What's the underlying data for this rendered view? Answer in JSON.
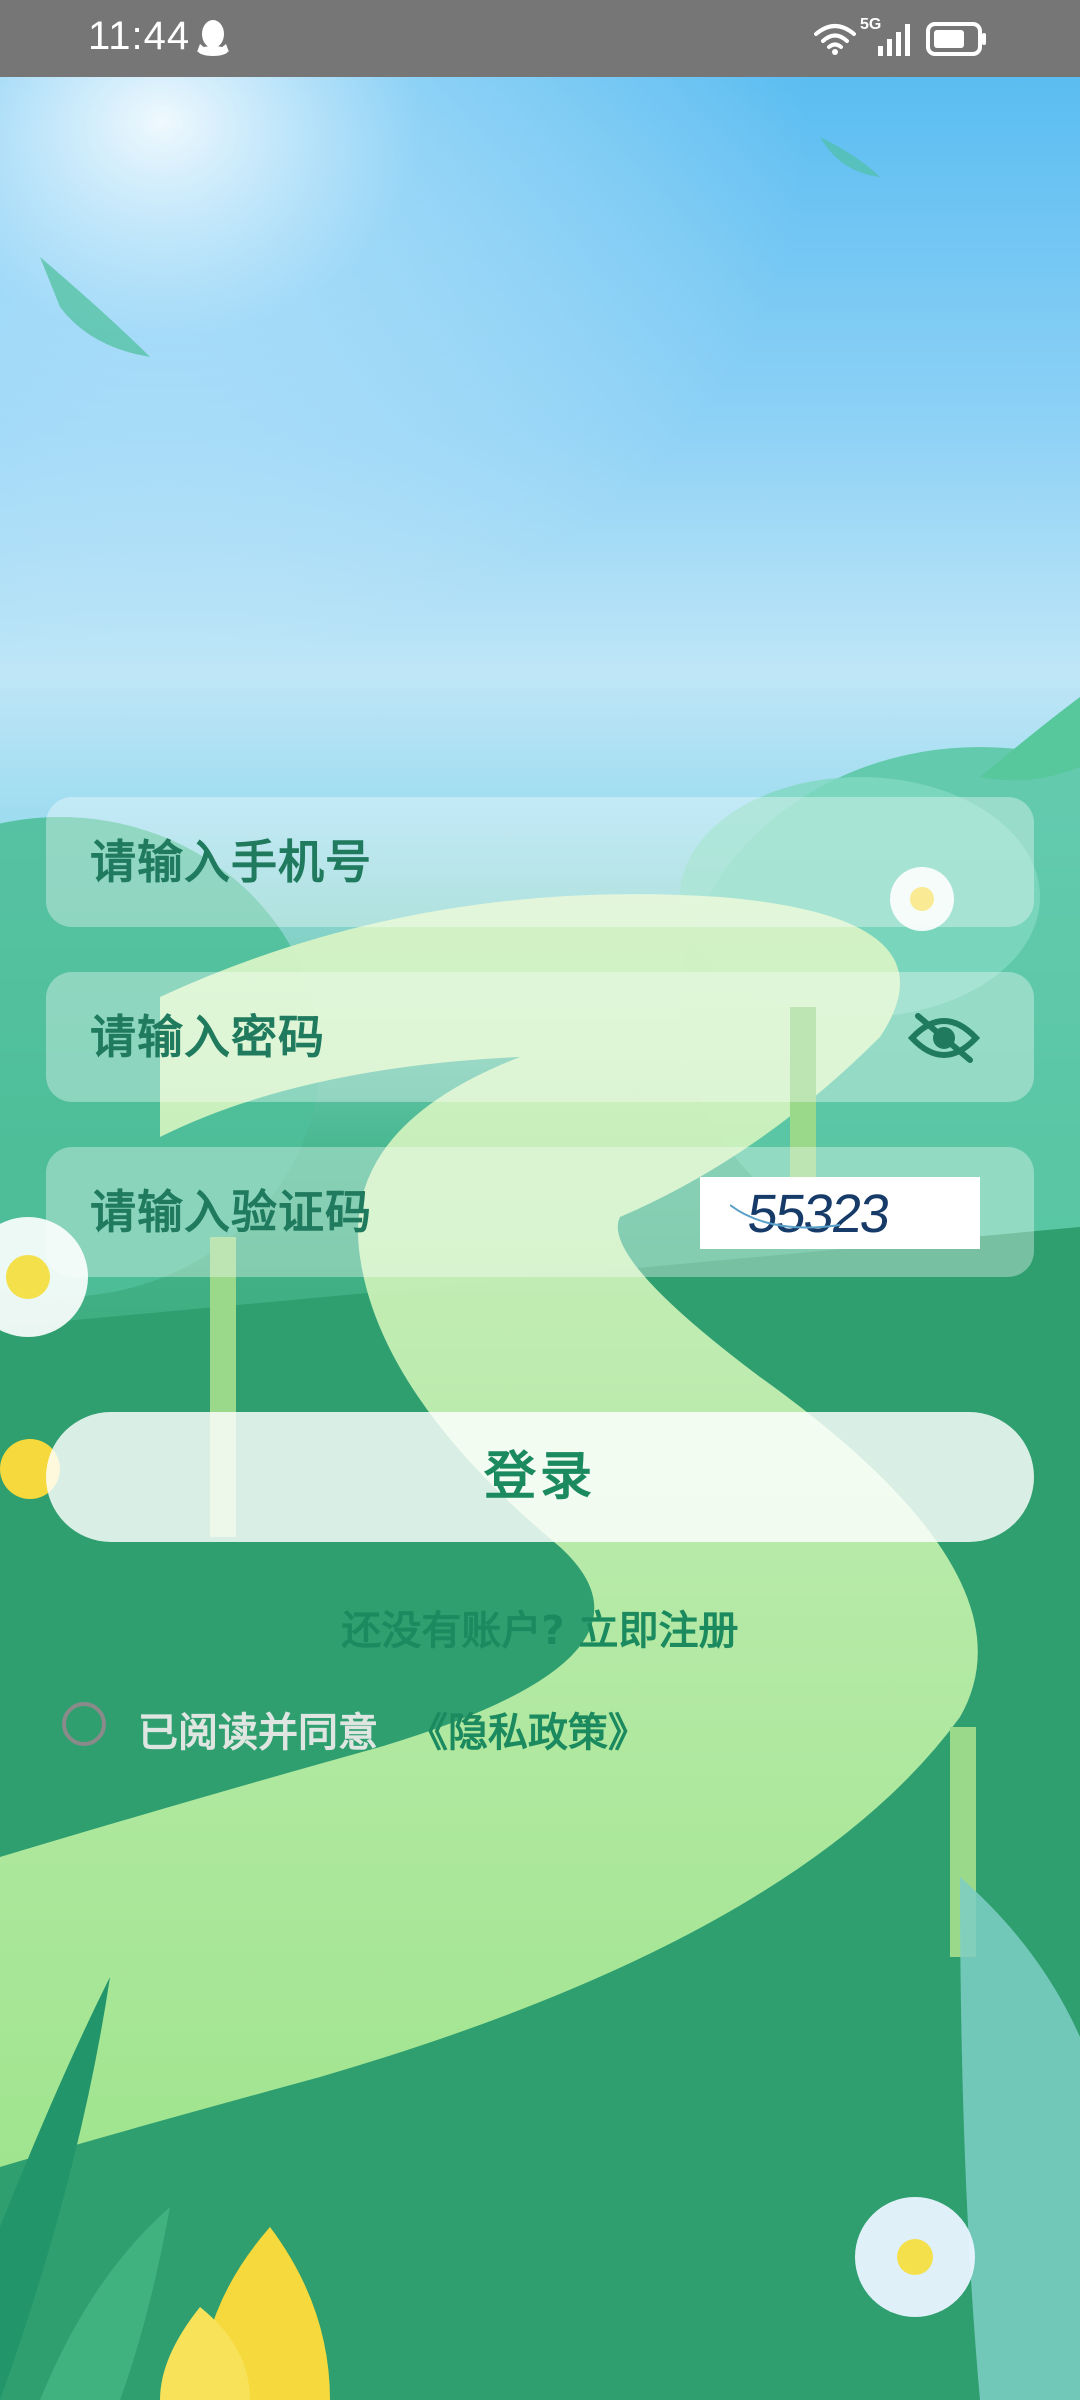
{
  "status_bar": {
    "time": "11:44",
    "network": "5G"
  },
  "form": {
    "phone_placeholder": "请输入手机号",
    "password_placeholder": "请输入密码",
    "captcha_placeholder": "请输入验证码",
    "captcha_code": "55323"
  },
  "actions": {
    "login_label": "登录",
    "register_link": "还没有账户? 立即注册"
  },
  "privacy": {
    "agree_text": "已阅读并同意",
    "policy_link": "《隐私政策》"
  },
  "colors": {
    "accent": "#1b8a5f",
    "status_bar": "#767676"
  },
  "icons": [
    "qq-icon",
    "wifi-icon",
    "signal-icon",
    "battery-icon",
    "eye-off-icon"
  ]
}
